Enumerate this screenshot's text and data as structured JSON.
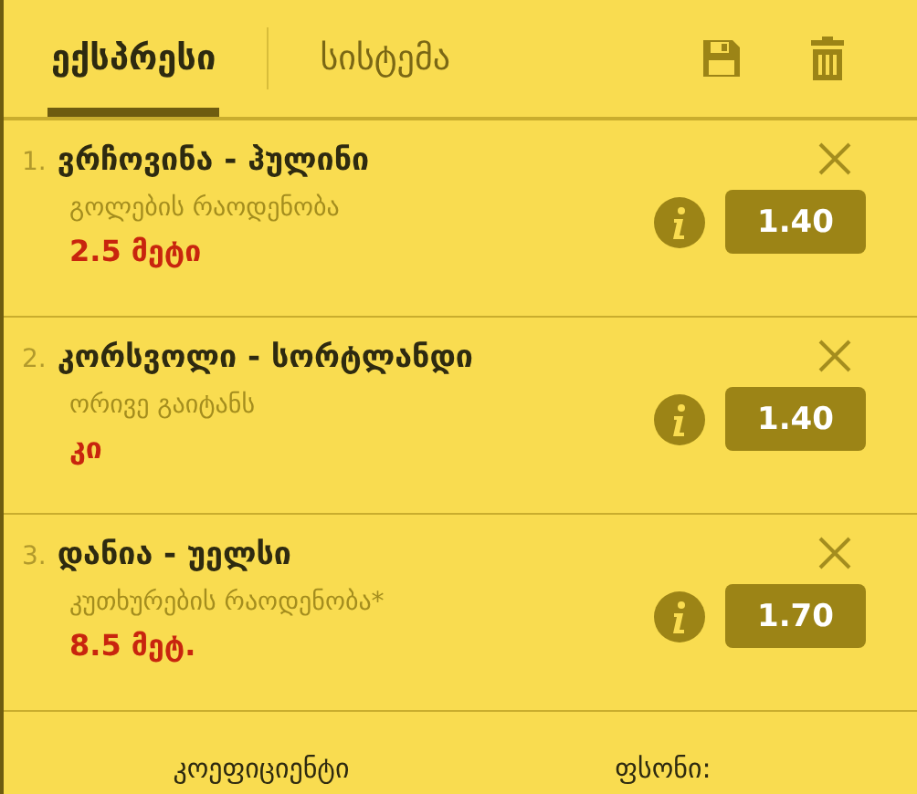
{
  "tabs": [
    {
      "label": "ექსპრესი",
      "selected": true
    },
    {
      "label": "სისტემა",
      "selected": false
    }
  ],
  "bets": [
    {
      "number": "1.",
      "match": "ვრჩოვინა - ჰულინი",
      "market": "გოლების რაოდენობა",
      "pick": "2.5 მეტი",
      "odds": "1.40"
    },
    {
      "number": "2.",
      "match": "კორსვოლი - სორტლანდი",
      "market": "ორივე გაიტანს",
      "pick": "კი",
      "odds": "1.40"
    },
    {
      "number": "3.",
      "match": "დანია - უელსი",
      "market": "კუთხურების რაოდენობა*",
      "pick": "8.5 მეტ.",
      "odds": "1.70"
    }
  ],
  "footer": {
    "odds_label": "კოეფიციენტი",
    "stake_label": "ფსონი:"
  }
}
